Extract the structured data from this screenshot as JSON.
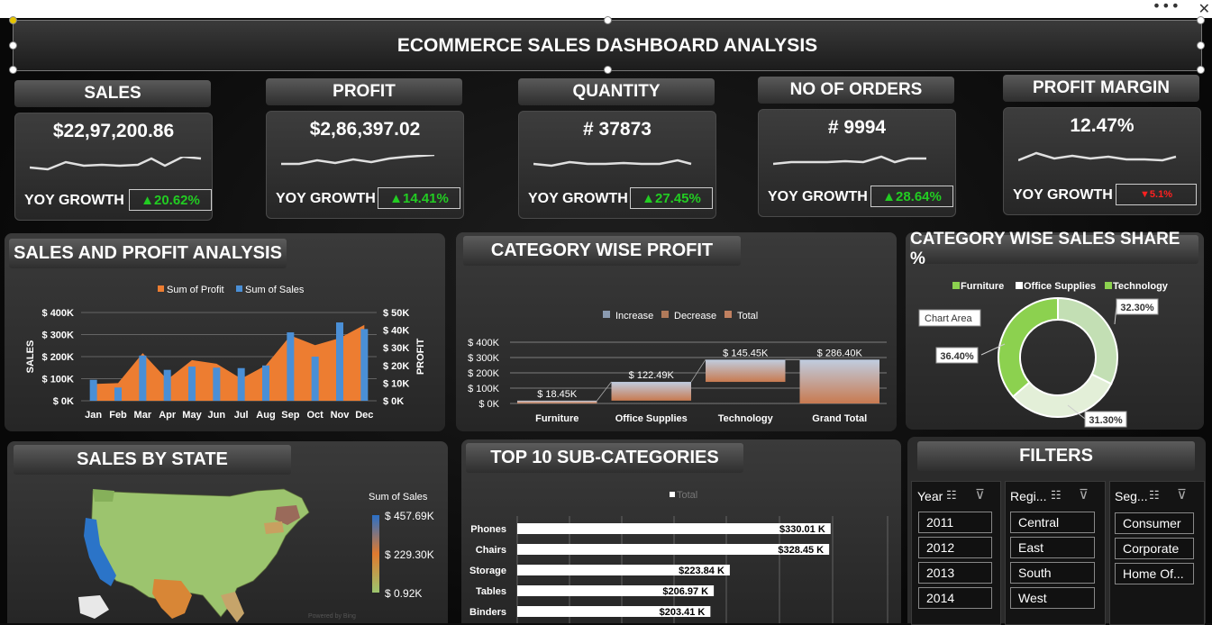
{
  "window": {
    "menu_dots": "•••",
    "close": "✕"
  },
  "dashboard": {
    "title": "ECOMMERCE SALES DASHBOARD ANALYSIS"
  },
  "kpis": [
    {
      "label": "SALES",
      "value": "$22,97,200.86",
      "yoy_label": "YOY GROWTH",
      "yoy": "▲20.62%",
      "trend": "up"
    },
    {
      "label": "PROFIT",
      "value": "$2,86,397.02",
      "yoy_label": "YOY GROWTH",
      "yoy": "▲14.41%",
      "trend": "up"
    },
    {
      "label": "QUANTITY",
      "value": "# 37873",
      "yoy_label": "YOY GROWTH",
      "yoy": "▲27.45%",
      "trend": "up"
    },
    {
      "label": "NO OF ORDERS",
      "value": "# 9994",
      "yoy_label": "YOY GROWTH",
      "yoy": "▲28.64%",
      "trend": "up"
    },
    {
      "label": "PROFIT MARGIN",
      "value": "12.47%",
      "yoy_label": "YOY GROWTH",
      "yoy": "▼5.1%",
      "trend": "down"
    }
  ],
  "colors": {
    "profit": "#ed7d31",
    "sales": "#4a8fd6",
    "up": "#22cc22",
    "down": "#ff2020",
    "donut_furniture": "#8cd14f",
    "donut_office": "#dcebd0",
    "donut_tech": "#c3dfb4"
  },
  "sales_profit": {
    "title": "SALES AND PROFIT ANALYSIS",
    "legend_profit": "Sum of Profit",
    "legend_sales": "Sum of Sales",
    "ylabel_left": "SALES",
    "ylabel_right": "PROFIT",
    "left_ticks": [
      "$ 400K",
      "$ 300K",
      "$ 200K",
      "$ 100K",
      "$ 0K"
    ],
    "right_ticks": [
      "$ 50K",
      "$ 40K",
      "$ 30K",
      "$ 20K",
      "$ 10K",
      "$ 0K"
    ]
  },
  "category_profit": {
    "title": "CATEGORY WISE PROFIT",
    "legend": [
      "Increase",
      "Decrease",
      "Total"
    ],
    "ticks": [
      "$ 400K",
      "$ 300K",
      "$ 200K",
      "$ 100K",
      "$ 0K"
    ],
    "labels": [
      "$ 18.45K",
      "$ 122.49K",
      "$ 145.45K",
      "$ 286.40K"
    ]
  },
  "sales_share": {
    "title": "CATEGORY WISE SALES SHARE %",
    "legend": [
      "Furniture",
      "Office Supplies",
      "Technology"
    ],
    "tooltip": "Chart Area",
    "labels": [
      "32.30%",
      "36.40%",
      "31.30%"
    ]
  },
  "sales_by_state": {
    "title": "SALES BY STATE",
    "legend_title": "Sum of Sales",
    "legend_max": "$ 457.69K",
    "legend_mid": "$ 229.30K",
    "legend_min": "$ 0.92K",
    "credit": "Powered by Bing"
  },
  "top_subcategories": {
    "title": "TOP 10 SUB-CATEGORIES",
    "legend": "Total",
    "labels": [
      "$330.01 K",
      "$328.45 K",
      "$223.84 K",
      "$206.97 K",
      "$203.41 K"
    ]
  },
  "filters": {
    "title": "FILTERS",
    "year_label": "Year",
    "region_label": "Regi...",
    "segment_label": "Seg...",
    "years": [
      "2011",
      "2012",
      "2013",
      "2014"
    ],
    "regions": [
      "Central",
      "East",
      "South",
      "West"
    ],
    "segments": [
      "Consumer",
      "Corporate",
      "Home Of..."
    ]
  },
  "chart_data": [
    {
      "type": "bar",
      "title": "SALES AND PROFIT ANALYSIS",
      "categories": [
        "Jan",
        "Feb",
        "Mar",
        "Apr",
        "May",
        "Jun",
        "Jul",
        "Aug",
        "Sep",
        "Oct",
        "Nov",
        "Dec"
      ],
      "series": [
        {
          "name": "Sum of Sales",
          "values": [
            95000,
            60000,
            205000,
            140000,
            155000,
            150000,
            148000,
            160000,
            310000,
            200000,
            355000,
            325000
          ]
        },
        {
          "name": "Sum of Profit",
          "values": [
            9500,
            10000,
            27000,
            12000,
            23000,
            21000,
            12500,
            20000,
            37000,
            31500,
            35500,
            43000
          ]
        }
      ],
      "ylim": [
        0,
        400000
      ],
      "y2lim": [
        0,
        50000
      ],
      "xlabel": "",
      "ylabel": "SALES",
      "y2label": "PROFIT"
    },
    {
      "type": "bar",
      "title": "CATEGORY WISE PROFIT",
      "categories": [
        "Furniture",
        "Office Supplies",
        "Technology",
        "Grand Total"
      ],
      "values": [
        18.45,
        122.49,
        145.45,
        286.4
      ],
      "units": "$K",
      "ylim": [
        0,
        400
      ]
    },
    {
      "type": "pie",
      "title": "CATEGORY WISE SALES SHARE %",
      "categories": [
        "Technology",
        "Office Supplies",
        "Furniture"
      ],
      "values": [
        36.4,
        31.3,
        32.3
      ]
    },
    {
      "type": "bar",
      "title": "TOP 10 SUB-CATEGORIES",
      "categories": [
        "Phones",
        "Chairs",
        "Storage",
        "Tables",
        "Binders"
      ],
      "values": [
        330.01,
        328.45,
        223.84,
        206.97,
        203.41
      ],
      "units": "$K"
    }
  ]
}
